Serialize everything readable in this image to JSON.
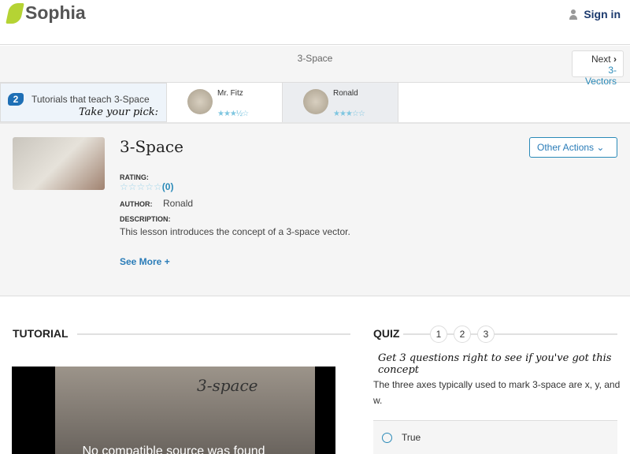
{
  "header": {
    "brand": "Sophia",
    "sign_in": "Sign in"
  },
  "nav": {
    "title": "3-Space",
    "next_label": "Next",
    "next_target": "3-Vectors"
  },
  "picks": {
    "count": "2",
    "intro": "Tutorials that teach 3-Space",
    "pick": "Take your pick:",
    "tutors": [
      {
        "name": "Mr. Fitz",
        "stars": "★★★½☆"
      },
      {
        "name": "Ronald",
        "stars": "★★★☆☆"
      }
    ]
  },
  "summary": {
    "title": "3-Space",
    "rating_label": "RATING:",
    "rating_stars": "☆☆☆☆☆",
    "rating_count": "(0)",
    "author_label": "AUTHOR:",
    "author": "Ronald",
    "description_label": "DESCRIPTION:",
    "description": "This lesson introduces the concept of a 3-space vector.",
    "see_more": "See More +",
    "other_actions": "Other Actions ⌄"
  },
  "tutorial": {
    "heading": "TUTORIAL",
    "video_text": "3-space",
    "video_error": "No compatible source was found"
  },
  "quiz": {
    "heading": "QUIZ",
    "questions": [
      "1",
      "2",
      "3"
    ],
    "tagline": "Get 3 questions right to see if you've got this concept",
    "question": "The three axes typically used to mark 3-space are x, y, and w.",
    "options": [
      "True"
    ]
  }
}
